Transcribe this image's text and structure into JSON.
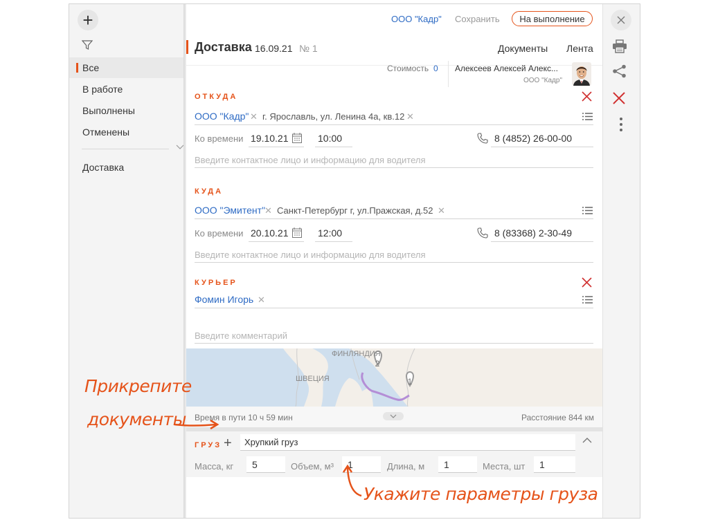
{
  "sidebar": {
    "items": [
      {
        "label": "Все"
      },
      {
        "label": "В работе"
      },
      {
        "label": "Выполнены"
      },
      {
        "label": "Отменены"
      },
      {
        "label": "Доставка"
      }
    ]
  },
  "topbar": {
    "org_link": "ООО \"Кадр\"",
    "save_label": "Сохранить",
    "run_label": "На выполнение"
  },
  "doc": {
    "title": "Доставка",
    "date": "16.09.21",
    "number": "№ 1",
    "documents_link": "Документы",
    "feed_link": "Лента",
    "cost_label": "Стоимость",
    "cost_value": "0",
    "user_name": "Алексеев Алексей Алекс...",
    "user_org": "ООО \"Кадр\""
  },
  "from": {
    "title": "ОТКУДА",
    "org": "ООО \"Кадр\"",
    "address": "г. Ярославль, ул. Ленина 4а, кв.12",
    "time_label": "Ко времени",
    "date": "19.10.21",
    "time": "10:00",
    "phone": "8 (4852) 26-00-00",
    "contact_placeholder": "Введите контактное лицо и информацию для водителя"
  },
  "to": {
    "title": "КУДА",
    "org": "ООО \"Эмитент\"",
    "address": "Санкт-Петербург г, ул.Пражская, д.52",
    "time_label": "Ко времени",
    "date": "20.10.21",
    "time": "12:00",
    "phone": "8 (83368) 2-30-49",
    "contact_placeholder": "Введите контактное лицо и информацию для водителя"
  },
  "courier": {
    "title": "КУРЬЕР",
    "name": "Фомин Игорь",
    "comment_placeholder": "Введите комментарий"
  },
  "map": {
    "label_finland": "ФИНЛЯНДИЯ",
    "label_sweden": "ШВЕЦИЯ",
    "marker_1": "1",
    "marker_2": "2",
    "travel_time": "Время в пути 10 ч 59 мин",
    "distance": "Расстояние 844 км"
  },
  "cargo": {
    "title": "ГРУЗ",
    "description": "Хрупкий груз",
    "mass_label": "Масса, кг",
    "mass_value": "5",
    "volume_label": "Объем, м³",
    "volume_value": "1",
    "length_label": "Длина, м",
    "length_value": "1",
    "places_label": "Места, шт",
    "places_value": "1"
  },
  "annotations": {
    "attach_docs_line1": "Прикрепите",
    "attach_docs_line2": "документы",
    "cargo_params": "Укажите параметры груза"
  },
  "colors": {
    "accent": "#e5531a",
    "link": "#2e6bc4",
    "delete": "#d03030"
  }
}
